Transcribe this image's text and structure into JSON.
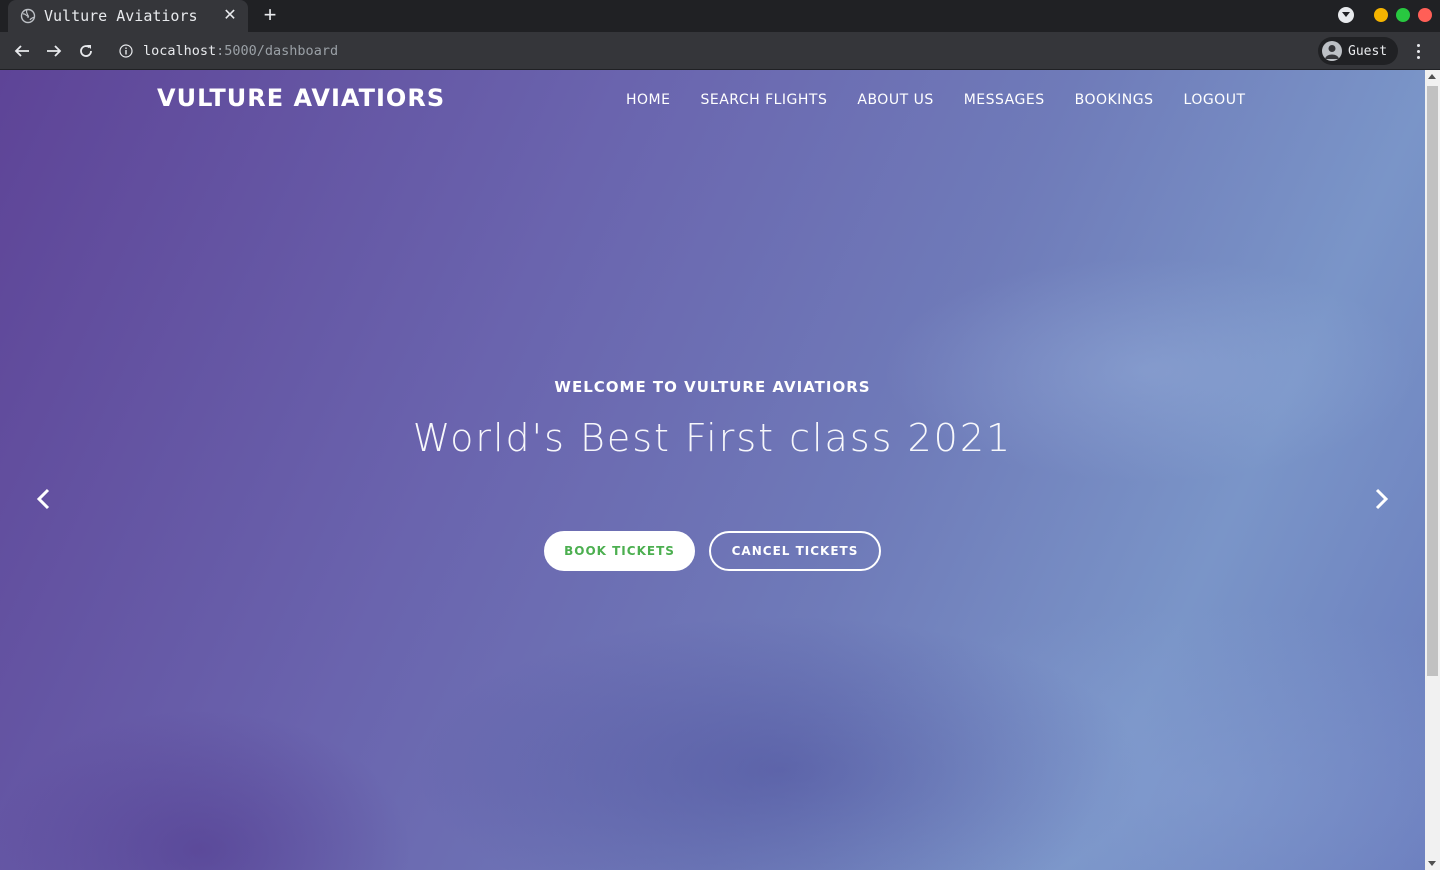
{
  "browser": {
    "tab_title": "Vulture Aviatiors",
    "url_host": "localhost",
    "url_path": ":5000/dashboard",
    "profile_label": "Guest",
    "window_dot_colors": [
      "#f5b400",
      "#28c840",
      "#ff5f57"
    ]
  },
  "site": {
    "brand": "VULTURE AVIATIORS",
    "nav": [
      "HOME",
      "SEARCH FLIGHTS",
      "ABOUT US",
      "MESSAGES",
      "BOOKINGS",
      "LOGOUT"
    ]
  },
  "hero": {
    "subtitle": "WELCOME TO VULTURE AVIATIORS",
    "title": "World's Best First class 2021",
    "primary_button": "BOOK TICKETS",
    "secondary_button": "CANCEL TICKETS",
    "primary_button_text_color": "#4caf50"
  },
  "icons": {
    "favicon": "globe-icon",
    "prev": "chevron-left-icon",
    "next": "chevron-right-icon"
  }
}
